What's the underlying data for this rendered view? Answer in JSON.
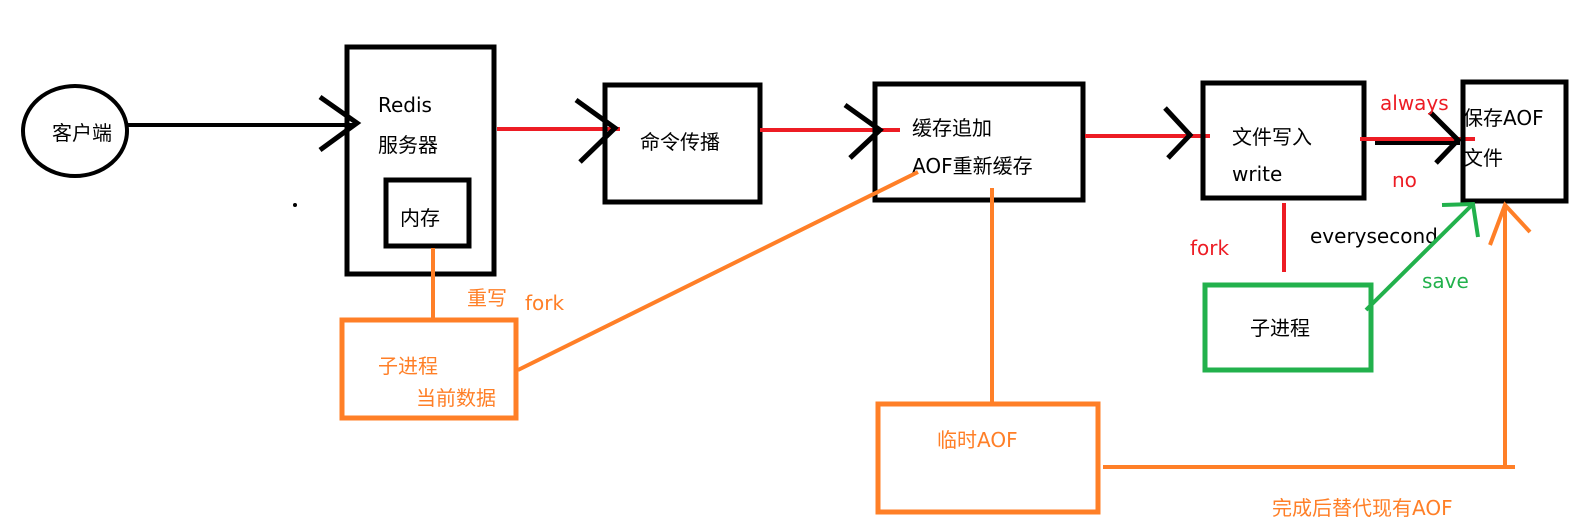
{
  "colors": {
    "black": "#000000",
    "red": "#ed1c24",
    "orange": "#ff7f27",
    "green": "#22b14c"
  },
  "nodes": {
    "client": "客户端",
    "redis_line1": "Redis",
    "redis_line2": "服务器",
    "memory": "内存",
    "propagation": "命令传播",
    "buffer_line1": "缓存追加",
    "buffer_line2": "AOF重新缓存",
    "file_write_line1": "文件写入",
    "file_write_line2": "write",
    "save_aof_line1": "保存AOF",
    "save_aof_line2": "文件",
    "child_process_green": "子进程",
    "child_process_orange_line1": "子进程",
    "child_process_orange_line2": "当前数据",
    "temp_aof": "临时AOF"
  },
  "labels": {
    "always": "always",
    "no": "no",
    "everysecond": "everysecond",
    "fork_red": "fork",
    "save": "save",
    "rewrite": "重写",
    "fork_orange": "fork",
    "replace": "完成后替代现有AOF"
  }
}
